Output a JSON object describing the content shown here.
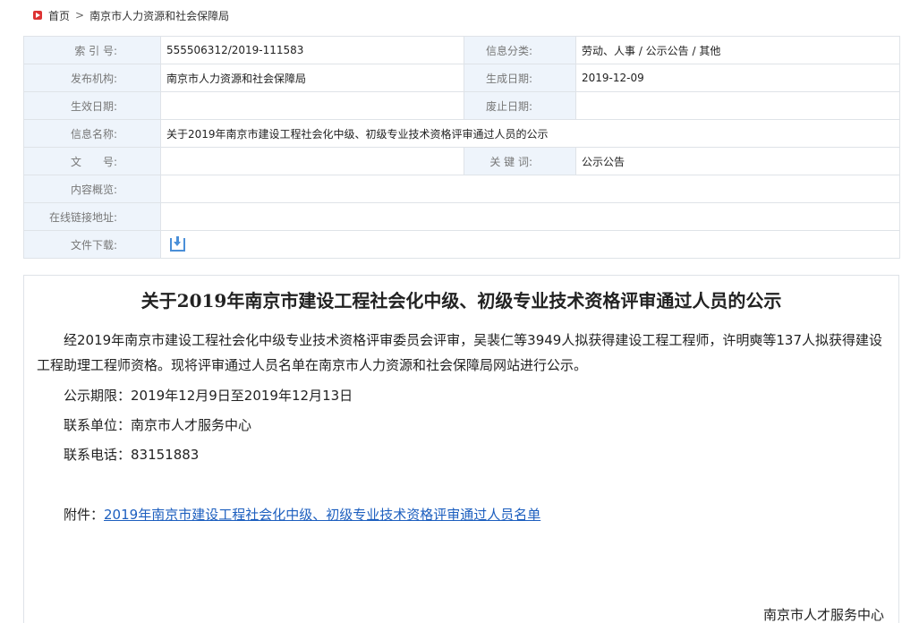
{
  "breadcrumb": {
    "home": "首页",
    "separator": ">",
    "current": "南京市人力资源和社会保障局"
  },
  "meta": {
    "index_label": "索 引 号:",
    "index_value": "555506312/2019-111583",
    "category_label": "信息分类:",
    "category_value": "劳动、人事 / 公示公告 / 其他",
    "publisher_label": "发布机构:",
    "publisher_value": "南京市人力资源和社会保障局",
    "created_label": "生成日期:",
    "created_value": "2019-12-09",
    "effective_label": "生效日期:",
    "effective_value": "",
    "expiry_label": "废止日期:",
    "expiry_value": "",
    "name_label": "信息名称:",
    "name_value": "关于2019年南京市建设工程社会化中级、初级专业技术资格评审通过人员的公示",
    "docno_label": "文　　号:",
    "docno_value": "",
    "keywords_label": "关 键 词:",
    "keywords_value": "公示公告",
    "summary_label": "内容概览:",
    "summary_value": "",
    "link_label": "在线链接地址:",
    "link_value": "",
    "download_label": "文件下载:",
    "download_icon": "download-icon"
  },
  "article": {
    "title": "关于2019年南京市建设工程社会化中级、初级专业技术资格评审通过人员的公示",
    "body": "经2019年南京市建设工程社会化中级专业技术资格评审委员会评审，吴裴仁等3949人拟获得建设工程工程师，许明奭等137人拟获得建设工程助理工程师资格。现将评审通过人员名单在南京市人力资源和社会保障局网站进行公示。",
    "period": "公示期限：2019年12月9日至2019年12月13日",
    "unit": "联系单位：南京市人才服务中心",
    "phone": "联系电话：83151883",
    "attach_label": "附件：",
    "attach_link": "2019年南京市建设工程社会化中级、初级专业技术资格评审通过人员名单",
    "signature": "南京市人才服务中心"
  },
  "colors": {
    "label_bg": "#eef4fb",
    "border": "#dfe3e8",
    "link": "#1d5fbf",
    "home_icon": "#dd3333"
  }
}
